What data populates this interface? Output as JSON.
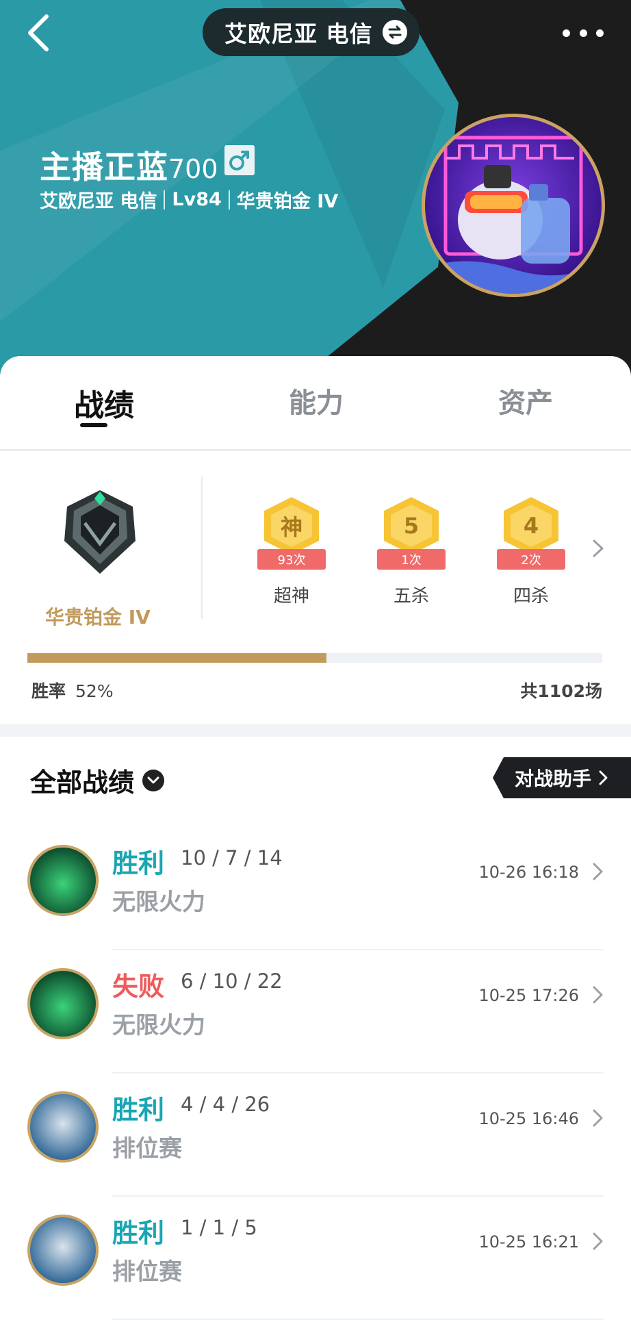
{
  "header": {
    "server": "艾欧尼亚 电信",
    "player_name": "主播正蓝",
    "player_name_suffix": "700",
    "meta_server": "艾欧尼亚 电信",
    "level": "Lv84",
    "rank": "华贵铂金 IV"
  },
  "tabs": [
    {
      "label": "战绩",
      "active": true
    },
    {
      "label": "能力",
      "active": false
    },
    {
      "label": "资产",
      "active": false
    }
  ],
  "stats": {
    "rank_label": "华贵铂金 IV",
    "badges": [
      {
        "icon": "神",
        "count": "93次",
        "label": "超神"
      },
      {
        "icon": "5",
        "count": "1次",
        "label": "五杀"
      },
      {
        "icon": "4",
        "count": "2次",
        "label": "四杀"
      }
    ],
    "win_rate_label": "胜率",
    "win_rate_value": "52%",
    "win_rate_fraction": 0.52,
    "total_games": "共1102场"
  },
  "list": {
    "title": "全部战绩",
    "assistant_button": "对战助手",
    "matches": [
      {
        "result": "胜利",
        "outcome": "win",
        "kda": "10 / 7 / 14",
        "mode": "无限火力",
        "time": "10-26 16:18",
        "champion": "thresh"
      },
      {
        "result": "失败",
        "outcome": "loss",
        "kda": "6 / 10 / 22",
        "mode": "无限火力",
        "time": "10-25 17:26",
        "champion": "thresh"
      },
      {
        "result": "胜利",
        "outcome": "win",
        "kda": "4 / 4 / 26",
        "mode": "排位赛",
        "time": "10-25 16:46",
        "champion": "zilean"
      },
      {
        "result": "胜利",
        "outcome": "win",
        "kda": "1 / 1 / 5",
        "mode": "排位赛",
        "time": "10-25 16:21",
        "champion": "zilean"
      }
    ]
  },
  "colors": {
    "header_teal": "#2a9aa6",
    "win": "#19a5b3",
    "loss": "#ef5b5b",
    "gold": "#c29a5c"
  }
}
